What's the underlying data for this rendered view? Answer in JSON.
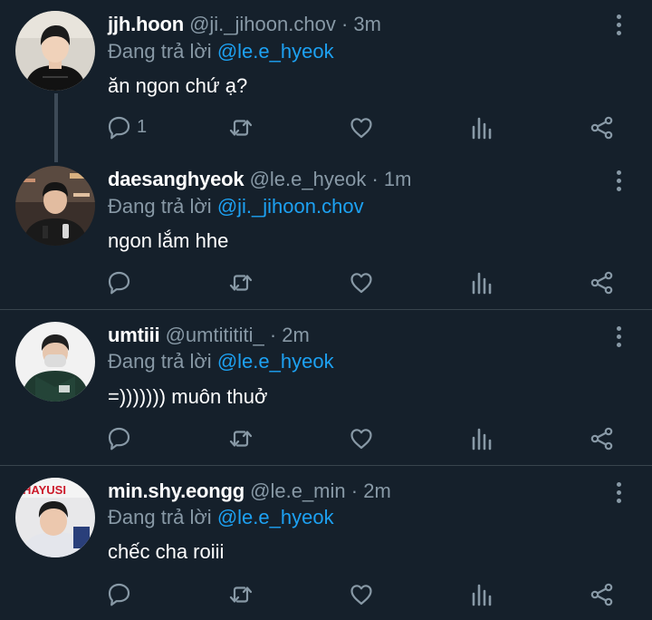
{
  "reply_prefix": "Đang trả lời",
  "colors": {
    "background": "#15202b",
    "secondary": "#8899a6",
    "accent": "#1da1f2",
    "divider": "#38444d"
  },
  "tweets": [
    {
      "name": "jjh.hoon",
      "handle": "@ji._jihoon.chov",
      "time": "· 3m",
      "reply_to": "@le.e_hyeok",
      "text": "ăn ngon chứ ạ?",
      "reply_count": "1"
    },
    {
      "name": "daesanghyeok",
      "handle": "@le.e_hyeok",
      "time": "· 1m",
      "reply_to": "@ji._jihoon.chov",
      "text": "ngon lắm hhe",
      "reply_count": ""
    },
    {
      "name": "umtiii",
      "handle": "@umtitititi_",
      "time": "· 2m",
      "reply_to": "@le.e_hyeok",
      "text": "=))))))) muôn thuở",
      "reply_count": ""
    },
    {
      "name": "min.shy.eongg",
      "handle": "@le.e_min",
      "time": "· 2m",
      "reply_to": "@le.e_hyeok",
      "text": "chếc cha roiii",
      "reply_count": ""
    }
  ],
  "avatar_badges": {
    "t4": "HAYUSI"
  }
}
